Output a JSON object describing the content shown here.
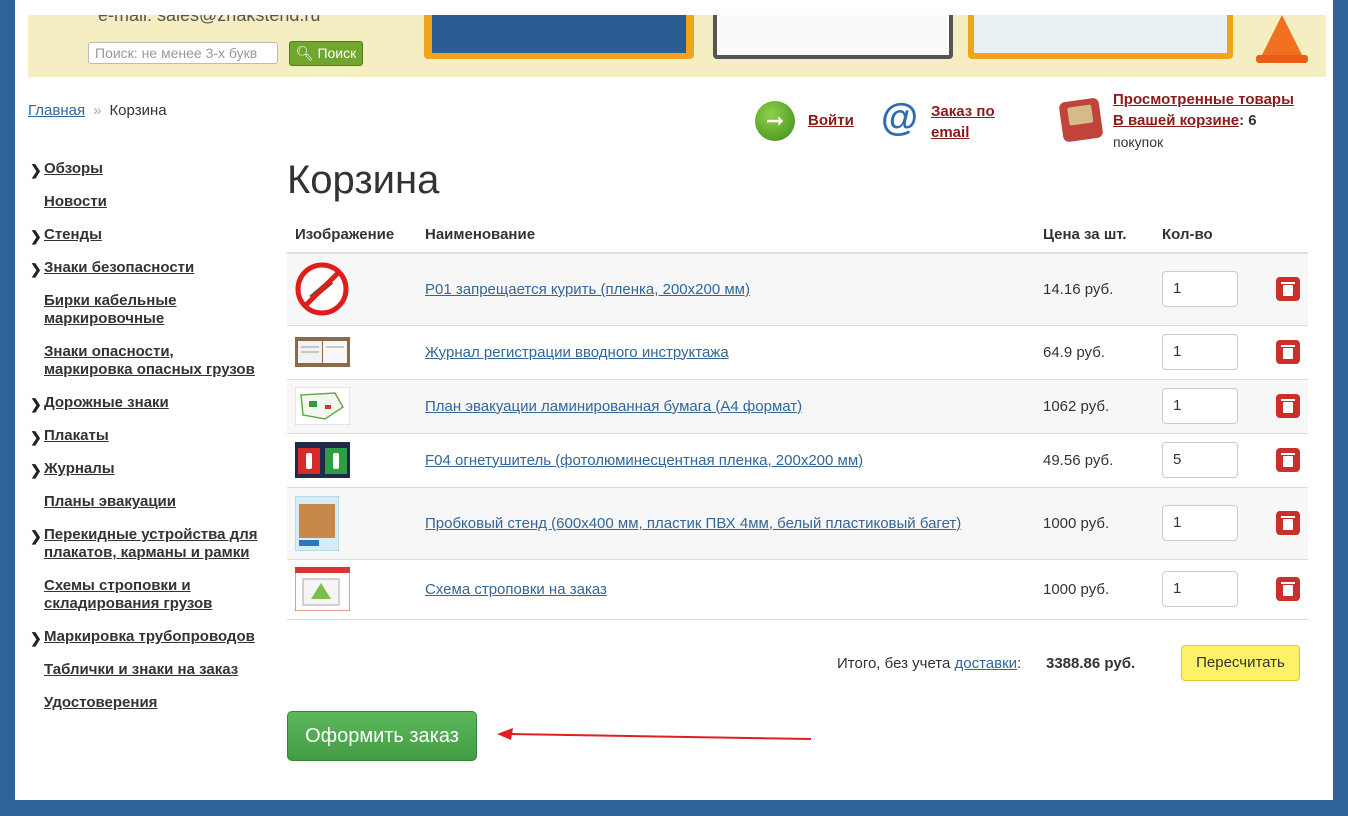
{
  "header": {
    "email_text": "e-mail: sales@znakstend.ru",
    "search_placeholder": "Поиск: не менее 3-х букв",
    "search_button": "Поиск"
  },
  "breadcrumb": {
    "home": "Главная",
    "sep": "»",
    "current": "Корзина"
  },
  "actions": {
    "login": "Войти",
    "email_order": "Заказ по email",
    "viewed": "Просмотренные товары",
    "in_cart": "В вашей корзине",
    "in_cart_count": ": 6",
    "purchases": "покупок"
  },
  "sidebar": {
    "items": [
      {
        "label": "Обзоры",
        "arrow": true
      },
      {
        "label": "Новости",
        "arrow": false
      },
      {
        "label": "Стенды",
        "arrow": true
      },
      {
        "label": "Знаки безопасности",
        "arrow": true
      },
      {
        "label": "Бирки кабельные маркировочные",
        "arrow": false
      },
      {
        "label": "Знаки опасности, маркировка опасных грузов",
        "arrow": false
      },
      {
        "label": "Дорожные знаки",
        "arrow": true
      },
      {
        "label": "Плакаты",
        "arrow": true
      },
      {
        "label": "Журналы",
        "arrow": true
      },
      {
        "label": "Планы эвакуации",
        "arrow": false
      },
      {
        "label": "Перекидные устройства для плакатов, карманы и рамки",
        "arrow": true
      },
      {
        "label": "Схемы строповки и складирования грузов",
        "arrow": false
      },
      {
        "label": "Маркировка трубопроводов",
        "arrow": true
      },
      {
        "label": "Таблички и знаки на заказ",
        "arrow": false
      },
      {
        "label": "Удостоверения",
        "arrow": false
      }
    ]
  },
  "cart": {
    "title": "Корзина",
    "columns": [
      "Изображение",
      "Наименование",
      "Цена за шт.",
      "Кол-во"
    ],
    "rows": [
      {
        "name": "Р01 запрещается курить (пленка, 200х200 мм)",
        "price": "14.16 руб.",
        "qty": "1",
        "thumb": "no-smoking"
      },
      {
        "name": "Журнал регистрации вводного инструктажа",
        "price": "64.9 руб.",
        "qty": "1",
        "thumb": "journal"
      },
      {
        "name": "План эвакуации ламинированная бумага (А4 формат)",
        "price": "1062 руб.",
        "qty": "1",
        "thumb": "evac-plan"
      },
      {
        "name": "F04 огнетушитель (фотолюминесцентная пленка, 200х200 мм)",
        "price": "49.56 руб.",
        "qty": "5",
        "thumb": "extinguisher"
      },
      {
        "name": "Пробковый стенд (600х400 мм, пластик ПВХ 4мм, белый пластиковый багет)",
        "price": "1000 руб.",
        "qty": "1",
        "thumb": "cork-board"
      },
      {
        "name": "Схема строповки на заказ",
        "price": "1000 руб.",
        "qty": "1",
        "thumb": "sling-scheme"
      }
    ],
    "total_prefix": "Итого, без учета ",
    "total_link": "доставки",
    "total_suffix": ":",
    "total_value": "3388.86 руб.",
    "recalc": "Пересчитать",
    "checkout": "Оформить заказ"
  },
  "colors": {
    "frame": "#2e6399",
    "link_dark": "#8b1a1a",
    "link_blue": "#336699",
    "checkout_green": "#4cae4c",
    "recalc_yellow": "#fef167",
    "delete_red": "#c9302c",
    "arrow_red": "#e02020"
  }
}
